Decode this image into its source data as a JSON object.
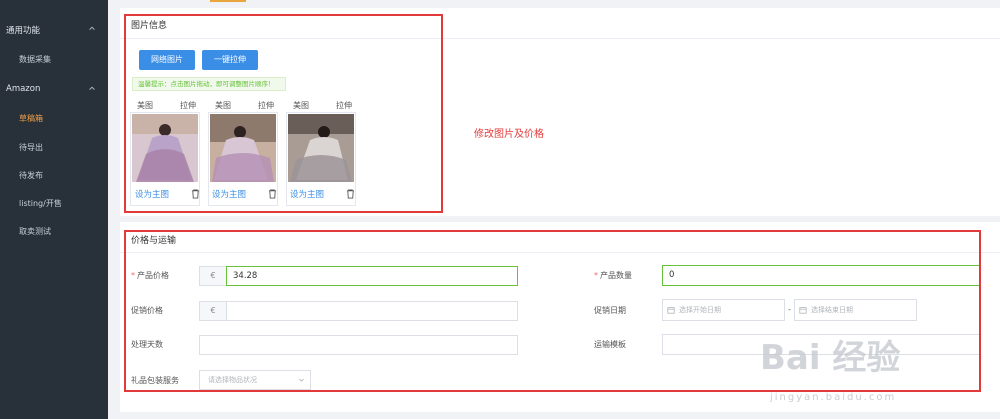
{
  "sidebar": {
    "groups": [
      {
        "label": "通用功能",
        "items": [
          "数据采集"
        ]
      },
      {
        "label": "Amazon",
        "items": [
          "草稿箱",
          "待导出",
          "待发布",
          "listing/开售",
          "取卖测试"
        ]
      }
    ],
    "active_item": "草稿箱"
  },
  "image_section": {
    "title": "图片信息",
    "btn_network": "网络图片",
    "btn_stretch": "一键拉伸",
    "tip": "温馨提示：点击图片拖动，即可调整图片顺序！",
    "cards": [
      {
        "action_left": "美图",
        "action_right": "拉伸",
        "set_main": "设为主图"
      },
      {
        "action_left": "美图",
        "action_right": "拉伸",
        "set_main": "设为主图"
      },
      {
        "action_left": "美图",
        "action_right": "拉伸",
        "set_main": "设为主图"
      }
    ],
    "annotation": "修改图片及价格"
  },
  "price_section": {
    "title": "价格与运输",
    "product_price_label": "产品价格",
    "currency_symbol": "€",
    "product_price_value": "34.28",
    "product_qty_label": "产品数量",
    "product_qty_value": "0",
    "sale_price_label": "促销价格",
    "sale_date_label": "促销日期",
    "date_start_placeholder": "选择开始日期",
    "date_sep": "-",
    "date_end_placeholder": "选择结束日期",
    "handling_days_label": "处理天数",
    "shipping_template_label": "运输模板",
    "gift_service_label": "礼品包装服务",
    "gift_service_placeholder": "请选择物品状况"
  },
  "watermark": {
    "brand": "Bai 经验",
    "url": "jingyan.baidu.com"
  },
  "colors": {
    "sidebar_bg": "#28303a",
    "accent": "#e8a73c",
    "primary": "#3a8ee6",
    "annotation": "#e23a3a",
    "success": "#67c23a"
  }
}
